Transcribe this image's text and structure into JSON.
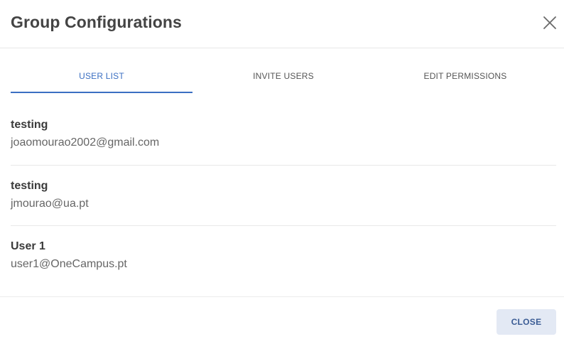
{
  "dialog": {
    "title": "Group Configurations",
    "close_icon": "close-icon"
  },
  "tabs": [
    {
      "label": "USER LIST",
      "active": true
    },
    {
      "label": "INVITE USERS",
      "active": false
    },
    {
      "label": "EDIT PERMISSIONS",
      "active": false
    }
  ],
  "users": [
    {
      "name": "testing",
      "email": "joaomourao2002@gmail.com"
    },
    {
      "name": "testing",
      "email": "jmourao@ua.pt"
    },
    {
      "name": "User 1",
      "email": "user1@OneCampus.pt"
    }
  ],
  "footer": {
    "close_label": "CLOSE"
  },
  "colors": {
    "accent": "#3b6fc2",
    "close_button_bg": "#e3e9f4",
    "close_button_text": "#3b5c95"
  }
}
